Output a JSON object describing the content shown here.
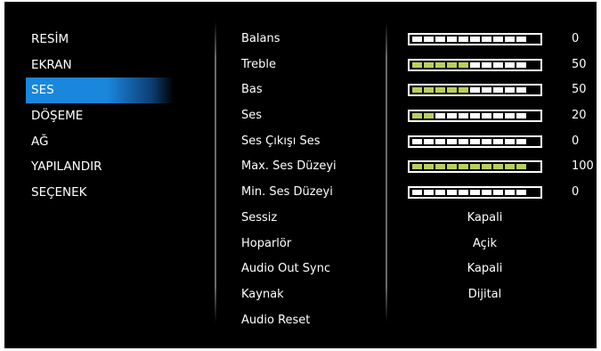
{
  "menu": {
    "items": [
      "RESİM",
      "EKRAN",
      "SES",
      "DÖŞEME",
      "AĞ",
      "YAPILANDIR",
      "SEÇENEK"
    ],
    "selected_index": 2
  },
  "settings": [
    {
      "label": "Balans",
      "kind": "slider",
      "value": "0",
      "level": 0
    },
    {
      "label": "Treble",
      "kind": "slider",
      "value": "50",
      "level": 0.5
    },
    {
      "label": "Bas",
      "kind": "slider",
      "value": "50",
      "level": 0.5
    },
    {
      "label": "Ses",
      "kind": "slider",
      "value": "20",
      "level": 0.2
    },
    {
      "label": "Ses Çıkışı Ses",
      "kind": "slider",
      "value": "0",
      "level": 0
    },
    {
      "label": "Max. Ses Düzeyi",
      "kind": "slider",
      "value": "100",
      "level": 1
    },
    {
      "label": "Min. Ses Düzeyi",
      "kind": "slider",
      "value": "0",
      "level": 0
    },
    {
      "label": "Sessiz",
      "kind": "option",
      "value": "Kapali"
    },
    {
      "label": "Hoparlör",
      "kind": "option",
      "value": "Açik"
    },
    {
      "label": "Audio Out Sync",
      "kind": "option",
      "value": "Kapali"
    },
    {
      "label": "Kaynak",
      "kind": "option",
      "value": "Dijital"
    },
    {
      "label": "Audio Reset",
      "kind": "action",
      "value": ""
    }
  ],
  "colors": {
    "background": "#000000",
    "text": "#ffffff",
    "selected": "#1a86dc",
    "slider_filled": "#b9d05a",
    "slider_empty": "#ffffff"
  }
}
